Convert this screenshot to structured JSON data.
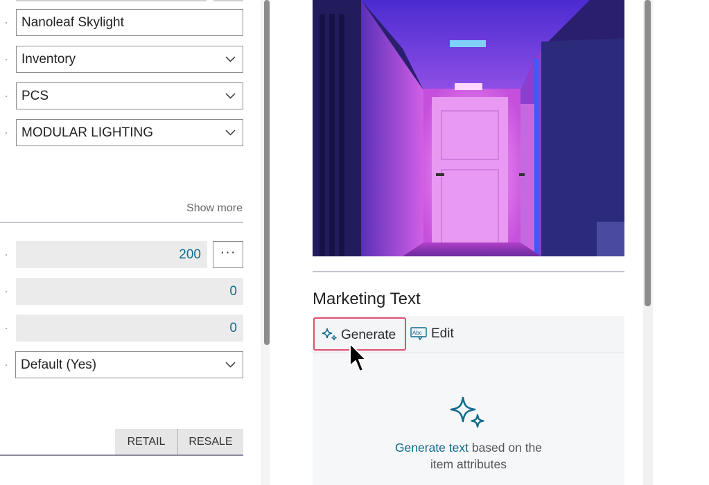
{
  "form": {
    "description_value": "Nanoleaf Skylight",
    "type_value": "Inventory",
    "unit_value": "PCS",
    "category_value": "MODULAR LIGHTING",
    "show_more_label": "Show more",
    "inventory_value": "200",
    "ellipsis_label": "···",
    "qty_on_po_value": "0",
    "qty_on_so_value": "0",
    "default_value": "Default (Yes)",
    "retail_label": "RETAIL",
    "resale_label": "RESALE"
  },
  "marketing": {
    "title": "Marketing Text",
    "generate_label": "Generate",
    "edit_label": "Edit",
    "edit_icon_text": "Abc",
    "empty_link": "Generate text",
    "empty_rest": " based on the",
    "empty_line2": "item attributes"
  },
  "colors": {
    "accent": "#0f6b8f",
    "highlight_border": "#e0506e"
  },
  "icons": [
    "chevron-down-icon",
    "sparkle-icon",
    "edit-text-icon",
    "mouse-cursor-icon"
  ]
}
